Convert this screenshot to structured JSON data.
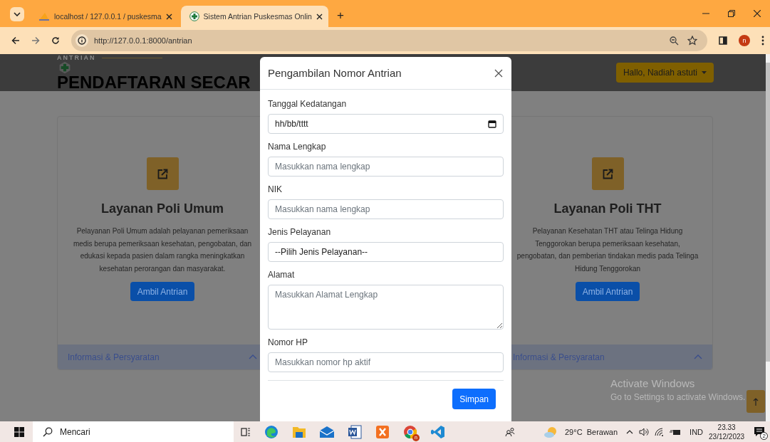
{
  "browser": {
    "tabs": [
      {
        "title": "localhost / 127.0.0.1 / puskesma",
        "selected": false,
        "kind": "pma"
      },
      {
        "title": "Sistem Antrian Puskesmas Onlin",
        "selected": true,
        "kind": "app"
      }
    ],
    "new_tab": "+",
    "url": "http://127.0.0.1:8000/antrian",
    "profile_letter": "n"
  },
  "header": {
    "eyebrow": "ANTRIAN",
    "title": "PENDAFTARAN SECAR",
    "user_menu": "Hallo, Nadiah astuti"
  },
  "cards": [
    {
      "title": "Layanan Poli Umum",
      "description": "Pelayanan Poli Umum adalah pelayanan pemeriksaan medis berupa pemeriksaan kesehatan, pengobatan, dan edukasi kepada pasien dalam rangka meningkatkan kesehatan perorangan dan masyarakat.",
      "button": "Ambil Antrian",
      "accordion": "Informasi & Persyaratan",
      "expanded": false
    },
    {
      "title": "Layanan Poli THT",
      "description": "Pelayanan Kesehatan THT atau Telinga Hidung Tenggorokan berupa pemeriksaan kesehatan, pengobatan, dan pemberian tindakan medis pada Telinga Hidung Tenggorokan",
      "button": "Ambil Antrian",
      "accordion": "Informasi & Persyaratan",
      "expanded": false
    }
  ],
  "modal": {
    "title": "Pengambilan Nomor Antrian",
    "fields": [
      {
        "kind": "date",
        "label": "Tanggal Kedatangan",
        "value": "hh/bb/tttt"
      },
      {
        "kind": "text",
        "label": "Nama Lengkap",
        "placeholder": "Masukkan nama lengkap"
      },
      {
        "kind": "text",
        "label": "NIK",
        "placeholder": "Masukkan nama lengkap"
      },
      {
        "kind": "select",
        "label": "Jenis Pelayanan",
        "value": "--Pilih Jenis Pelayanan--"
      },
      {
        "kind": "textarea",
        "label": "Alamat",
        "placeholder": "Masukkan Alamat Lengkap"
      },
      {
        "kind": "text",
        "label": "Nomor HP",
        "placeholder": "Masukkan nomor hp aktif"
      }
    ],
    "submit": "Simpan"
  },
  "activation_notice": {
    "title": "Activate Windows",
    "subtitle": "Go to Settings to activate Windows."
  },
  "taskbar": {
    "search_placeholder": "Mencari",
    "chrome_badge": "n",
    "weather": "29°C  Berawan",
    "language": "IND",
    "time": "23.33",
    "date": "23/12/2023",
    "notifications": "2"
  }
}
